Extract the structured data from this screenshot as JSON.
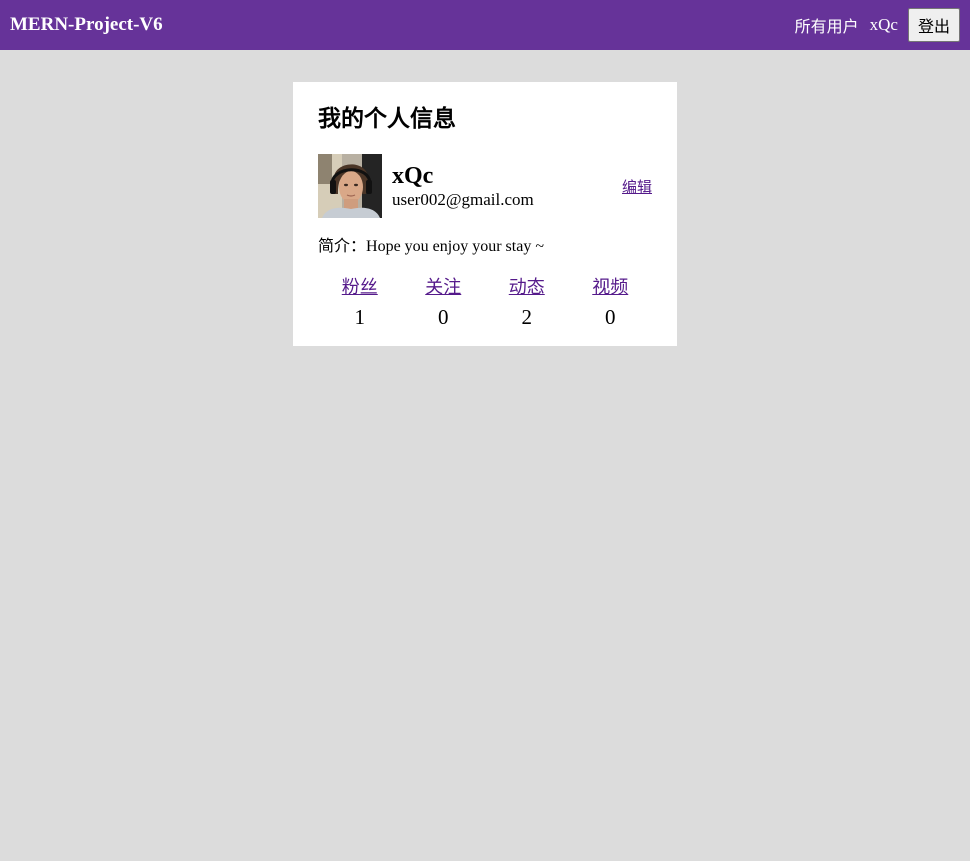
{
  "nav": {
    "brand": "MERN-Project-V6",
    "all_users": "所有用户",
    "current_user": "xQc",
    "logout": "登出"
  },
  "profile": {
    "title": "我的个人信息",
    "username": "xQc",
    "email": "user002@gmail.com",
    "edit": "编辑",
    "bio_label": "简介：",
    "bio": "Hope you enjoy your stay ~",
    "stats": [
      {
        "label": "粉丝",
        "count": "1"
      },
      {
        "label": "关注",
        "count": "0"
      },
      {
        "label": "动态",
        "count": "2"
      },
      {
        "label": "视频",
        "count": "0"
      }
    ]
  },
  "colors": {
    "navbar": "#663399",
    "background": "#dcdcdc",
    "link": "#551a8b"
  }
}
